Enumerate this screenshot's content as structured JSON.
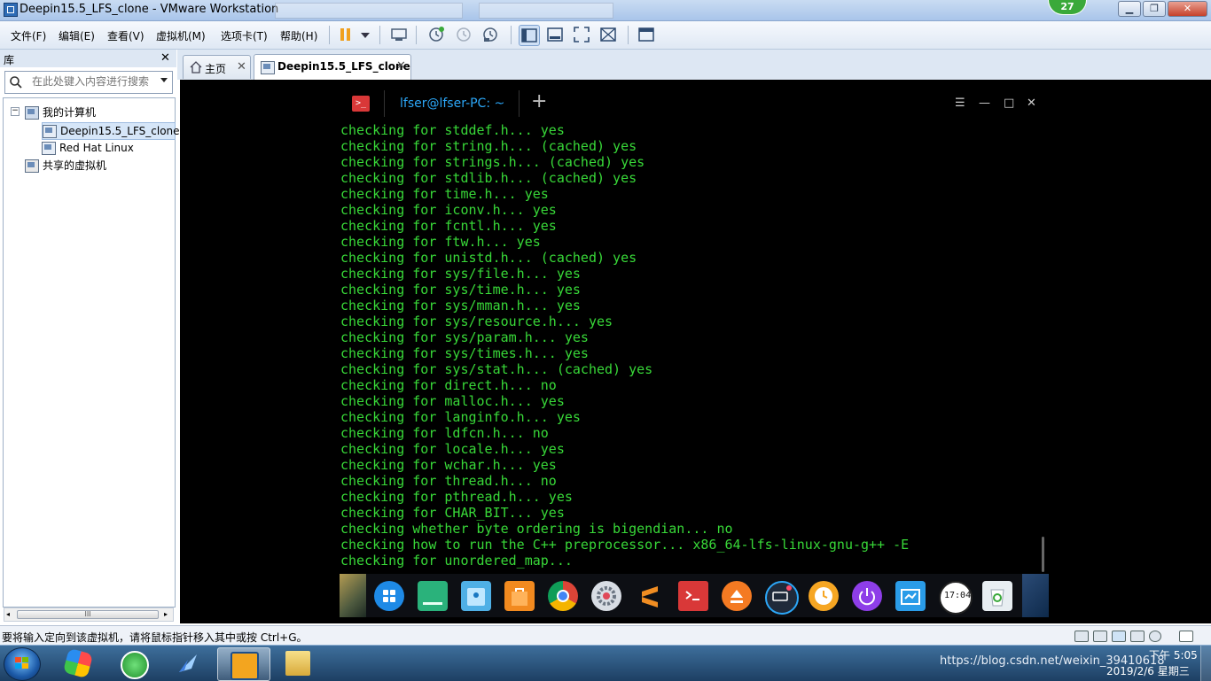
{
  "window": {
    "title": "Deepin15.5_LFS_clone - VMware Workstation",
    "notification_badge": "27"
  },
  "menus": [
    "文件(F)",
    "编辑(E)",
    "查看(V)",
    "虚拟机(M)",
    "选项卡(T)",
    "帮助(H)"
  ],
  "library": {
    "title": "库",
    "search_placeholder": "在此处键入内容进行搜索",
    "tree": {
      "root": "我的计算机",
      "vms": [
        "Deepin15.5_LFS_clone",
        "Red Hat Linux"
      ],
      "shared": "共享的虚拟机"
    },
    "scroll_label": "III"
  },
  "tabs": [
    {
      "label": "主页"
    },
    {
      "label": "Deepin15.5_LFS_clone"
    }
  ],
  "terminal": {
    "tab_title": "lfser@lfser-PC: ~",
    "lines": [
      "checking for stddef.h... yes",
      "checking for string.h... (cached) yes",
      "checking for strings.h... (cached) yes",
      "checking for stdlib.h... (cached) yes",
      "checking for time.h... yes",
      "checking for iconv.h... yes",
      "checking for fcntl.h... yes",
      "checking for ftw.h... yes",
      "checking for unistd.h... (cached) yes",
      "checking for sys/file.h... yes",
      "checking for sys/time.h... yes",
      "checking for sys/mman.h... yes",
      "checking for sys/resource.h... yes",
      "checking for sys/param.h... yes",
      "checking for sys/times.h... yes",
      "checking for sys/stat.h... (cached) yes",
      "checking for direct.h... no",
      "checking for malloc.h... yes",
      "checking for langinfo.h... yes",
      "checking for ldfcn.h... no",
      "checking for locale.h... yes",
      "checking for wchar.h... yes",
      "checking for thread.h... no",
      "checking for pthread.h... yes",
      "checking for CHAR_BIT... yes",
      "checking whether byte ordering is bigendian... no",
      "checking how to run the C++ preprocessor... x86_64-lfs-linux-gnu-g++ -E",
      "checking for unordered_map..."
    ],
    "clock_icon_text": "17:04"
  },
  "statusbar": {
    "text": "要将输入定向到该虚拟机，请将鼠标指针移入其中或按 Ctrl+G。"
  },
  "taskbar": {
    "tray_text": "https://blog.csdn.net/weixin_39410618",
    "clock_time": "下午 5:05",
    "clock_date": "2019/2/6 星期三"
  },
  "colors": {
    "terminal_text": "#38d838",
    "terminal_title": "#2ca7f8",
    "accent": "#1c5aa8"
  },
  "icons": {
    "toolbar": [
      "pause-icon",
      "dropdown-icon",
      "send-keys-icon",
      "snapshot-icon",
      "revert-snapshot-icon",
      "snapshot-manager-icon",
      "library-view-icon",
      "fullscreen-icon",
      "unity-icon",
      "stretch-icon",
      "console-view-icon"
    ],
    "dock": [
      "launcher-icon",
      "deepin-store-icon",
      "file-manager-icon",
      "app-store-icon",
      "chrome-icon",
      "settings-icon",
      "sublime-icon",
      "terminal-icon",
      "eject-icon",
      "keyboard-icon",
      "clock-app-icon",
      "power-icon",
      "screenshot-icon",
      "clock-icon",
      "trash-icon"
    ]
  }
}
